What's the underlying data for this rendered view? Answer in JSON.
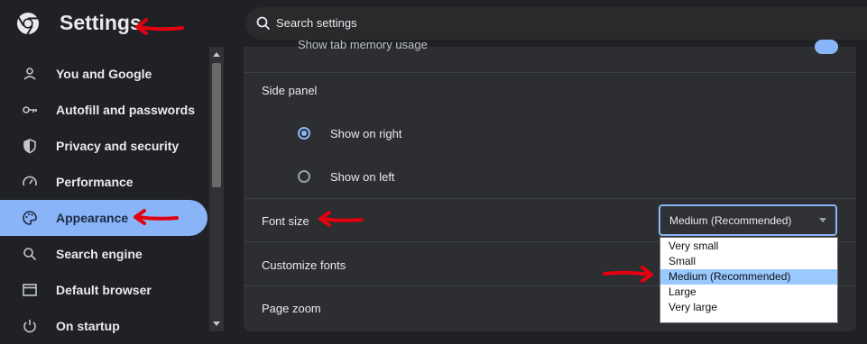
{
  "header": {
    "title": "Settings",
    "search_placeholder": "Search settings"
  },
  "sidebar": {
    "items": [
      {
        "label": "You and Google",
        "icon": "person-icon"
      },
      {
        "label": "Autofill and passwords",
        "icon": "key-icon"
      },
      {
        "label": "Privacy and security",
        "icon": "shield-icon"
      },
      {
        "label": "Performance",
        "icon": "speedometer-icon"
      },
      {
        "label": "Appearance",
        "icon": "palette-icon",
        "selected": true
      },
      {
        "label": "Search engine",
        "icon": "search-icon"
      },
      {
        "label": "Default browser",
        "icon": "browser-window-icon"
      },
      {
        "label": "On startup",
        "icon": "power-icon"
      }
    ]
  },
  "main": {
    "cut_row_label": "Show tab memory usage",
    "side_panel": {
      "label": "Side panel",
      "options": [
        {
          "label": "Show on right",
          "checked": true
        },
        {
          "label": "Show on left",
          "checked": false
        }
      ]
    },
    "font_size": {
      "label": "Font size",
      "value": "Medium (Recommended)",
      "options": [
        "Very small",
        "Small",
        "Medium (Recommended)",
        "Large",
        "Very large"
      ],
      "highlighted": "Medium (Recommended)"
    },
    "customize_fonts_label": "Customize fonts",
    "page_zoom_label": "Page zoom"
  },
  "colors": {
    "accent": "#8ab4f8",
    "annotation_arrow": "#e3000f",
    "dropdown_highlight": "#99c9ff"
  }
}
